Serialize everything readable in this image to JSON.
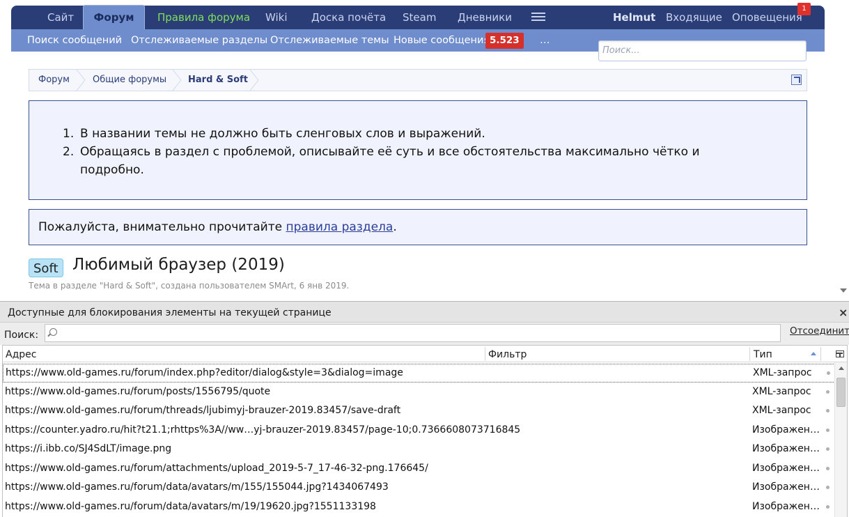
{
  "navbar": {
    "items": [
      "Сайт",
      "Форум",
      "Правила форума",
      "Wiki",
      "Доска почёта",
      "Steam",
      "Дневники"
    ],
    "user": "Helmut",
    "inbox": "Входящие",
    "alerts": "Оповещения",
    "alerts_badge": "1"
  },
  "subnav": {
    "items": [
      "Поиск сообщений",
      "Отслеживаемые разделы",
      "Отслеживаемые темы",
      "Новые сообщения"
    ],
    "new_count": "5.523",
    "more": "…",
    "search_placeholder": "Поиск..."
  },
  "breadcrumb": [
    "Форум",
    "Общие форумы",
    "Hard & Soft"
  ],
  "rules": [
    "В названии темы не должно быть сленговых слов и выражений.",
    "Обращаясь в раздел с проблемой, описывайте её суть и все обстоятельства максимально чётко и подробно."
  ],
  "notice": {
    "prefix": "Пожалуйста, внимательно прочитайте ",
    "link": "правила раздела",
    "suffix": "."
  },
  "thread": {
    "tag": "Soft",
    "title": "Любимый браузер (2019)",
    "meta": "Тема в разделе \"Hard & Soft\", создана пользователем SMArt, 6 янв 2019."
  },
  "panel": {
    "title": "Доступные для блокирования элементы на текущей странице",
    "close": "×",
    "search_label": "Поиск:",
    "detach": "Отсоединить",
    "columns": {
      "address": "Адрес",
      "filter": "Фильтр",
      "type": "Тип"
    },
    "rows": [
      {
        "address": "https://www.old-games.ru/forum/index.php?editor/dialog&style=3&dialog=image",
        "filter": "",
        "type": "XML-запрос"
      },
      {
        "address": "https://www.old-games.ru/forum/posts/1556795/quote",
        "filter": "",
        "type": "XML-запрос"
      },
      {
        "address": "https://www.old-games.ru/forum/threads/ljubimyj-brauzer-2019.83457/save-draft",
        "filter": "",
        "type": "XML-запрос"
      },
      {
        "address": "https://counter.yadro.ru/hit?t21.1;rhttps%3A//ww…yj-brauzer-2019.83457/page-10;0.7366608073716845",
        "filter": "",
        "type": "Изображен…"
      },
      {
        "address": "https://i.ibb.co/SJ4SdLT/image.png",
        "filter": "",
        "type": "Изображен…"
      },
      {
        "address": "https://www.old-games.ru/forum/attachments/upload_2019-5-7_17-46-32-png.176645/",
        "filter": "",
        "type": "Изображен…"
      },
      {
        "address": "https://www.old-games.ru/forum/data/avatars/m/155/155044.jpg?1434067493",
        "filter": "",
        "type": "Изображен…"
      },
      {
        "address": "https://www.old-games.ru/forum/data/avatars/m/19/19620.jpg?1551133198",
        "filter": "",
        "type": "Изображен…"
      }
    ]
  },
  "colors": {
    "navbar": "#2a3d76",
    "navbar_active": "#6f8ccc",
    "subnav": "#6f8ccc",
    "badge_red": "#d6302a",
    "rules_link_green": "#7ee05a",
    "notice_bg": "#f0f3fd"
  }
}
